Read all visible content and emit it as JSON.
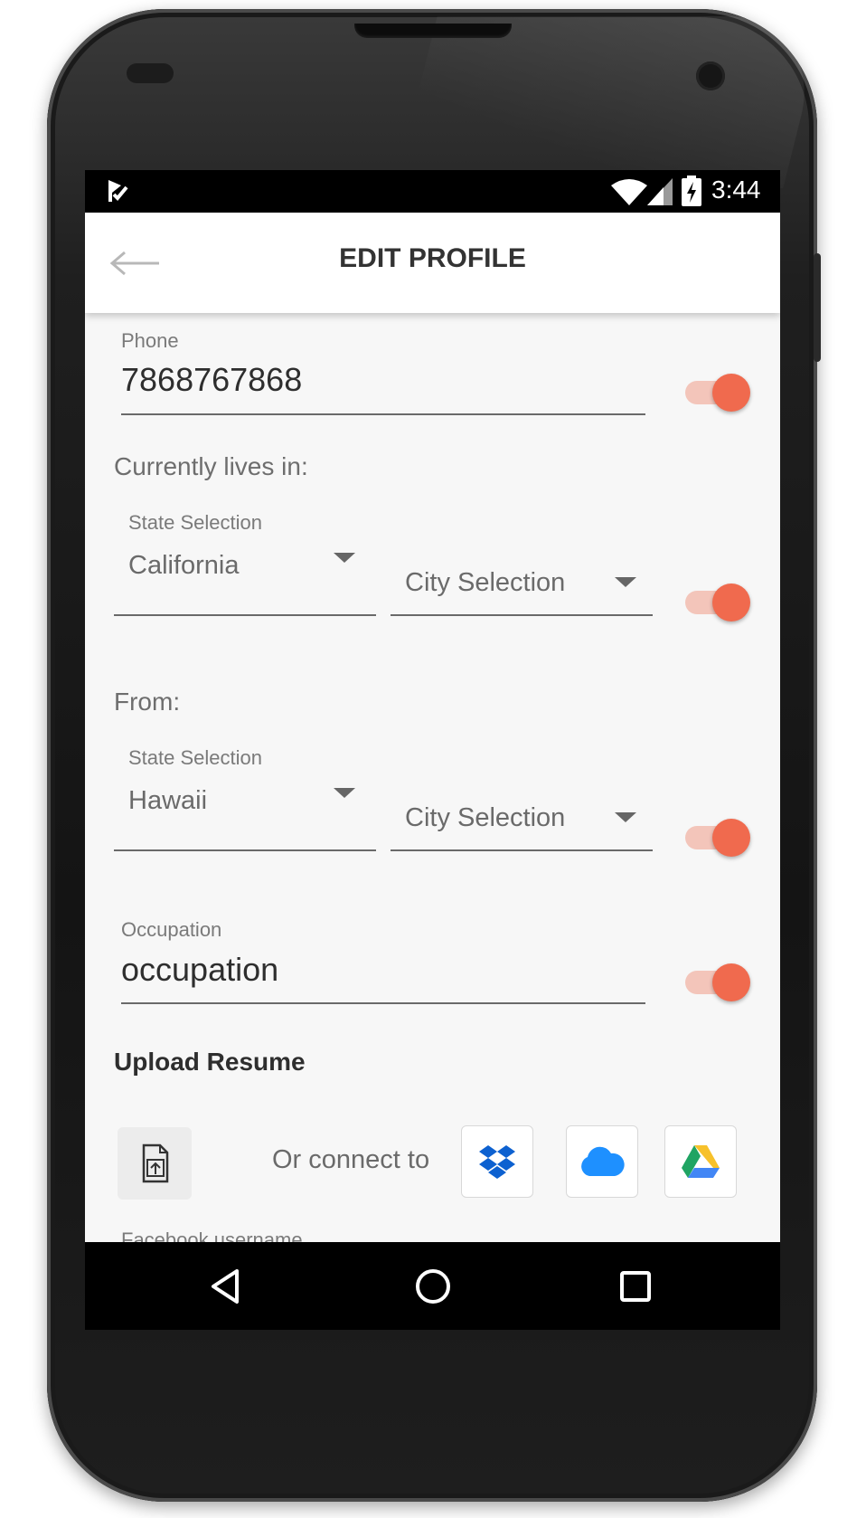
{
  "status_bar": {
    "time": "3:44",
    "app_icon": "check-flag-icon",
    "wifi_icon": "wifi-icon",
    "signal_icon": "signal-icon",
    "battery_icon": "battery-charging-icon"
  },
  "header": {
    "title": "EDIT PROFILE",
    "back_icon": "back-arrow-icon"
  },
  "phone": {
    "label": "Phone",
    "value": "7868767868",
    "visible": true
  },
  "current_residence": {
    "section_label": "Currently lives in:",
    "state_label": "State Selection",
    "state_value": "California",
    "city_placeholder": "City Selection",
    "visible": true
  },
  "origin": {
    "section_label": "From:",
    "state_label": "State Selection",
    "state_value": "Hawaii",
    "city_placeholder": "City Selection",
    "visible": true
  },
  "occupation": {
    "label": "Occupation",
    "value": "occupation",
    "visible": true
  },
  "resume": {
    "title": "Upload Resume",
    "connect_text": "Or connect to",
    "services": [
      "dropbox-icon",
      "onedrive-icon",
      "google-drive-icon"
    ]
  },
  "facebook": {
    "label": "Facebook username"
  },
  "nav": {
    "icons": [
      "back-triangle-icon",
      "home-circle-icon",
      "recents-square-icon"
    ]
  },
  "colors": {
    "accent": "#f06a4e",
    "accent_track": "#f3c5ba",
    "background": "#f7f7f7"
  }
}
